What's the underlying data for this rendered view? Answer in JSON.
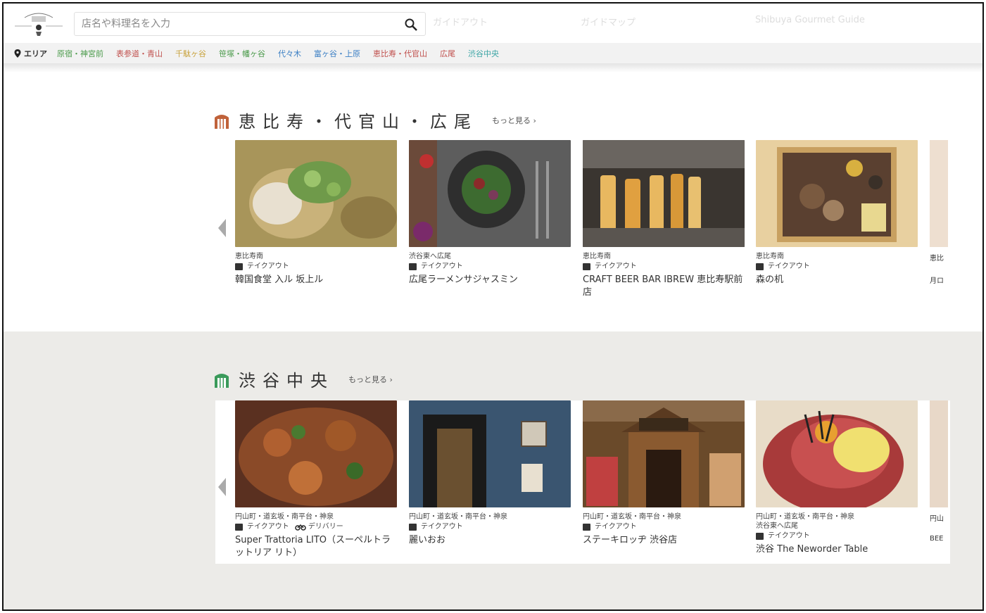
{
  "header": {
    "search_placeholder": "店名や料理名を入力",
    "faded_1": "ガイドアウト",
    "faded_2": "ガイドマップ",
    "faded_3": "Shibuya Gourmet Guide"
  },
  "areabar": {
    "label": "エリア",
    "links": [
      {
        "label": "原宿・神宮前",
        "color": "#4a9a4a"
      },
      {
        "label": "表参道・青山",
        "color": "#c0504d"
      },
      {
        "label": "千駄ヶ谷",
        "color": "#c8a23c"
      },
      {
        "label": "笹塚・幡ヶ谷",
        "color": "#4a9a4a"
      },
      {
        "label": "代々木",
        "color": "#3b7fc4"
      },
      {
        "label": "富ヶ谷・上原",
        "color": "#3b7fc4"
      },
      {
        "label": "恵比寿・代官山",
        "color": "#c0504d"
      },
      {
        "label": "広尾",
        "color": "#c0504d"
      },
      {
        "label": "渋谷中央",
        "color": "#3aa4a4"
      }
    ]
  },
  "sections": [
    {
      "title": "恵比寿・代官山・広尾",
      "icon_color": "#c0623a",
      "more": "もっと見る ›",
      "cards": [
        {
          "loc": "恵比寿南",
          "takeout": "テイクアウト",
          "name": "韓国食堂 入ル 坂上ル"
        },
        {
          "loc": "渋谷東へ広尾",
          "takeout": "テイクアウト",
          "name": "広尾ラーメンサジャスミン"
        },
        {
          "loc": "恵比寿南",
          "takeout": "テイクアウト",
          "name": "CRAFT BEER BAR IBREW 恵比寿駅前店"
        },
        {
          "loc": "恵比寿南",
          "takeout": "テイクアウト",
          "name": "森の机"
        }
      ],
      "stub": {
        "loc": "恵比",
        "name": "月ロ"
      }
    },
    {
      "title": "渋谷中央",
      "icon_color": "#3a9a5a",
      "more": "もっと見る ›",
      "cards": [
        {
          "loc": "円山町・道玄坂・南平台・神泉",
          "takeout": "テイクアウト",
          "delivery": "デリバリー",
          "name": "Super Trattoria LITO（スーペルトラットリア リト）"
        },
        {
          "loc": "円山町・道玄坂・南平台・神泉",
          "takeout": "テイクアウト",
          "name": "麗いおお"
        },
        {
          "loc": "円山町・道玄坂・南平台・神泉",
          "takeout": "テイクアウト",
          "name": "ステーキロッヂ 渋谷店"
        },
        {
          "loc": "円山町・道玄坂・南平台・神泉",
          "loc2": "渋谷東へ広尾",
          "takeout": "テイクアウト",
          "name": "渋谷 The Neworder Table"
        }
      ],
      "stub": {
        "loc": "円山",
        "name": "BEE"
      }
    }
  ],
  "colors": {
    "section2_bg": "#ecebe8",
    "accent_orange": "#c0623a",
    "accent_green": "#3a9a5a"
  }
}
